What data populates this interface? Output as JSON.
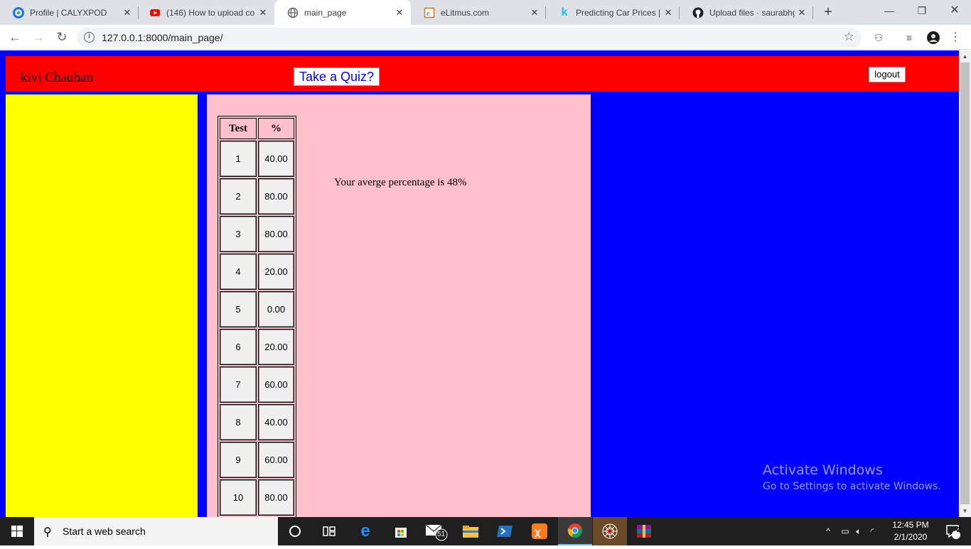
{
  "browser": {
    "tabs": [
      {
        "title": "Profile | CALYXPOD",
        "icon": "calyxpod-icon",
        "active": false
      },
      {
        "title": "(146) How to upload co",
        "icon": "youtube-icon",
        "active": false
      },
      {
        "title": "main_page",
        "icon": "globe-icon",
        "active": true
      },
      {
        "title": "eLitmus.com",
        "icon": "elitmus-icon",
        "active": false
      },
      {
        "title": "Predicting Car Prices | K",
        "icon": "kaggle-icon",
        "active": false
      },
      {
        "title": "Upload files · saurabhgu",
        "icon": "github-icon",
        "active": false
      }
    ],
    "url": "127.0.0.1:8000/main_page/"
  },
  "page": {
    "username": "kivi Chauhan",
    "quiz_button": "Take a Quiz?",
    "logout_button": "logout",
    "table": {
      "headers": [
        "Test",
        "%"
      ],
      "rows": [
        {
          "test": "1",
          "pct": "40.00"
        },
        {
          "test": "2",
          "pct": "80.00"
        },
        {
          "test": "3",
          "pct": "80.00"
        },
        {
          "test": "4",
          "pct": "20.00"
        },
        {
          "test": "5",
          "pct": "0.00"
        },
        {
          "test": "6",
          "pct": "20.00"
        },
        {
          "test": "7",
          "pct": "60.00"
        },
        {
          "test": "8",
          "pct": "40.00"
        },
        {
          "test": "9",
          "pct": "60.00"
        },
        {
          "test": "10",
          "pct": "80.00"
        }
      ]
    },
    "average_text": "Your averge percentage is 48%"
  },
  "watermark": {
    "line1": "Activate Windows",
    "line2": "Go to Settings to activate Windows."
  },
  "taskbar": {
    "search_placeholder": "Start a web search",
    "mail_badge": "51",
    "time": "12:45 PM",
    "date": "2/1/2020",
    "notification_count": "2"
  },
  "colors": {
    "header": "#ff0000",
    "page_bg": "#0000ff",
    "left_panel": "#ffff00",
    "main_panel": "#ffc0cb"
  }
}
